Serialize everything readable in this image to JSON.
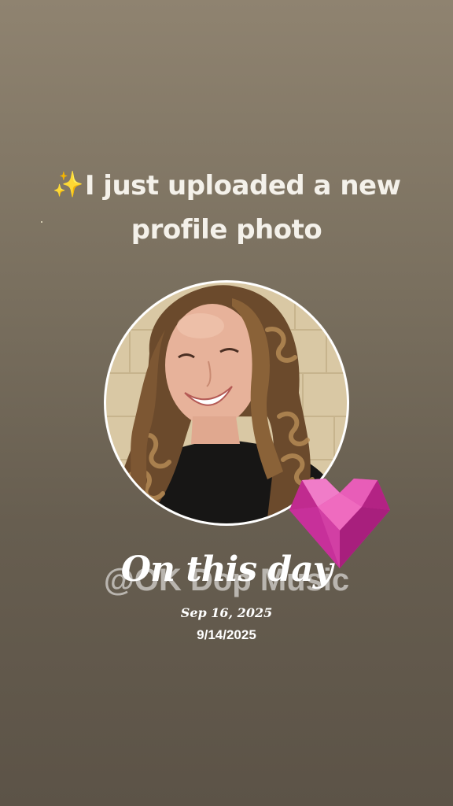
{
  "story": {
    "headline_icon": "sparkles-icon",
    "headline_line1": "I just uploaded a new",
    "headline_line2": "profile photo",
    "sparkle_glyph": "✨",
    "handle": "@OK Dop Music",
    "on_this_day": "On this day",
    "on_this_day_date": "Sep 16, 2025",
    "post_date": "9/14/2025",
    "sticker_icon": "gem-heart-icon"
  },
  "colors": {
    "background_top": "#8f8370",
    "background_bottom": "#5c5347",
    "text": "#f4f1ea",
    "heart": "#d93aa6",
    "sparkle": "#f3c74a"
  }
}
